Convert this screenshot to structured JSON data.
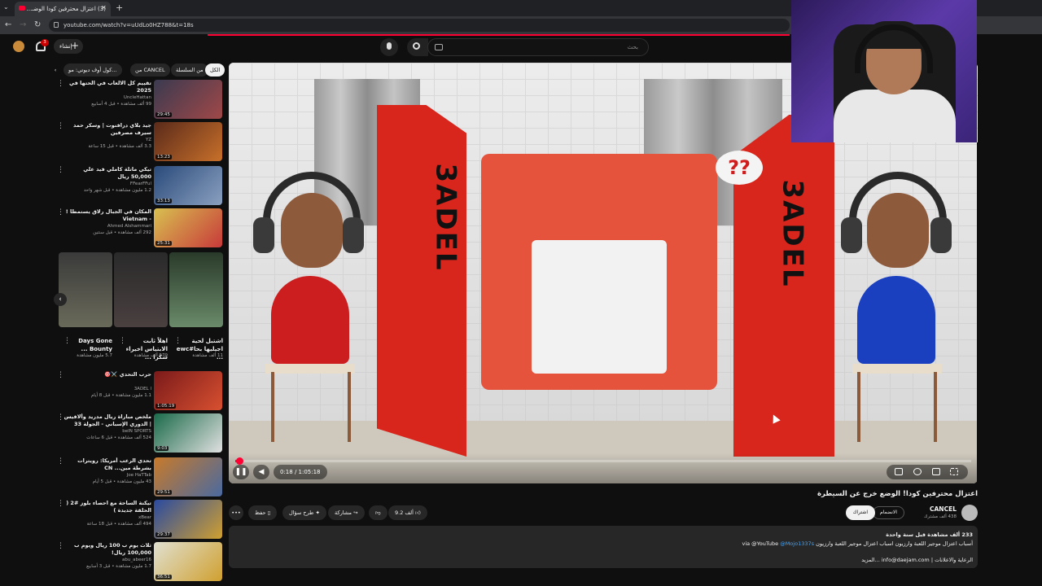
{
  "browser": {
    "tab_title": "(3) اعتزال محترفين كودا الوضـ...",
    "url": "youtube.com/watch?v=uUdLo0HZ788&t=18s"
  },
  "header": {
    "create_label": "إنشاء",
    "notif_count": "3",
    "search_placeholder": "بحث"
  },
  "chips": [
    "الكل",
    "من السلسلة",
    "من CANCEL",
    "كول أوف ديوتي: مو..."
  ],
  "recommendations": [
    {
      "title": "تقييم كل الالعاب في الحتها في 2025",
      "channel": "UncleHattan",
      "meta": "99 ألف مشاهدة • قبل 4 أسابيع",
      "duration": "29:45"
    },
    {
      "title": "جيد بلاي درافنوت | وسكر حمد سيرف مصرفين",
      "channel": "YZ",
      "meta": "3.3 ألف مشاهدة • قبل 15 ساعة",
      "duration": "13:23"
    },
    {
      "title": "تيكي ماتلة كاملي فيد علي 50,000 ريال",
      "channel": "FFearFFul",
      "meta": "1.2 مليون مشاهدة • قبل شهر واحد",
      "duration": "33:13"
    },
    {
      "title": "المكان في الجبال رلاق يستمطا ! - Vietnam",
      "channel": "Ahmed Alshammari",
      "meta": "292 ألف مشاهدة • قبل سنتين",
      "duration": "25:31"
    }
  ],
  "shelf": [
    {
      "title": "Days Gone Bounty ...",
      "meta": "5.7 مليون مشاهدة"
    },
    {
      "title": "اهلاً ثابت الابتياس اخيراء شكرا ...",
      "meta": "579 ألف مشاهدة"
    },
    {
      "title": "اشتبل لحية اجيليها بحا#ewc ...",
      "meta": "11 ألف مشاهدة"
    }
  ],
  "recommendations2": [
    {
      "title": "حرب التحدي ⚔️🎯",
      "channel": "3ADEL l",
      "meta": "1.1 مليون مشاهدة • قبل 8 أيام",
      "duration": "1:05:19"
    },
    {
      "title": "ملخص مباراة ريال مدريد وألافيس | الدوري الإسباني - الجولة 33",
      "channel": "beIN SPORTS",
      "meta": "524 ألف مشاهدة • قبل 6 ساعات",
      "duration": "9:03"
    },
    {
      "title": "تحدي الرعب أمريكا: رويترات بشرطة مين... CN",
      "channel": "Joe HaTTab",
      "meta": "43 مليون مشاهدة • قبل 5 أيام",
      "duration": "29:51"
    },
    {
      "title": "تيكنة الساحة مع احصاء بلوز #2 ( الحلقة جديدة )",
      "channel": "xBear",
      "meta": "494 ألف مشاهدة • قبل 18 ساعة",
      "duration": "29:37"
    },
    {
      "title": "ثلاث يوم ب 100 ريال ويوم ب 100,000 ريال!",
      "channel": "abu_abeer16",
      "meta": "1.7 مليون مشاهدة • قبل 3 أسابيع",
      "duration": "36:51"
    }
  ],
  "player": {
    "time": "0:18 / 1:05:18",
    "bubble_text": "??",
    "logo": "3ADEL",
    "progress_fraction": 0.005
  },
  "video": {
    "title": "اعتزال محترفين كودا! الوضع خرج عن السيطرة",
    "channel": "CANCEL",
    "subscribers": "438 ألف مشترك",
    "join": "الانضمام",
    "subscribe": "اشتراك",
    "likes": "9.2 ألف",
    "share": "مشاركة",
    "ask": "طرح سؤال",
    "save": "حفظ",
    "more": "•••"
  },
  "description": {
    "stats": "233 ألف مشاهدة  قبل سنة واحدة",
    "line1_text": "أسباب اعتزال موجير اللعبة وارزيون  اسباب اعتزال موجير اللعبة وارزيون",
    "line1_via": "via @YouTube",
    "line1_handle": "@Mojo1337s",
    "line2_text": "الرعاية والاعلانات |",
    "line2_email": "info@daejam.com",
    "line2_more": "...المزيد"
  },
  "colors": {
    "accent": "#ff0033",
    "background": "#0f0f0f",
    "surface": "#272727"
  }
}
